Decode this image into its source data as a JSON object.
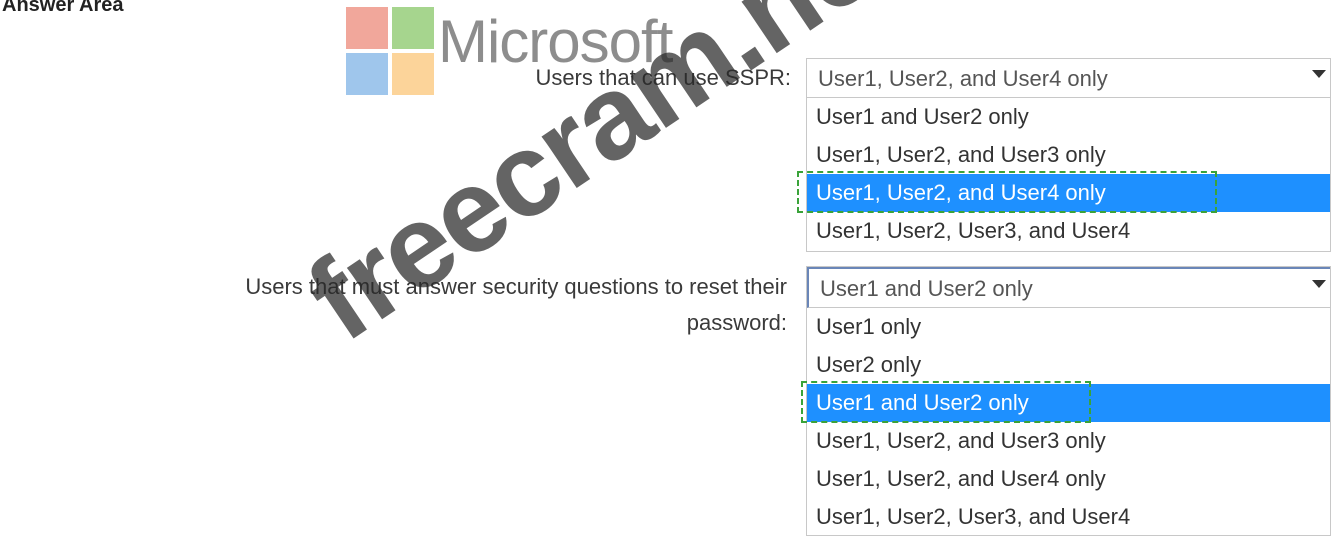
{
  "header": {
    "title": "Answer Area"
  },
  "logo": {
    "wordmark": "Microsoft",
    "colors": [
      "#f1a79b",
      "#a6d58e",
      "#9fc6ec",
      "#fcd49a"
    ]
  },
  "questions": [
    {
      "prompt": "Users that can use SSPR:",
      "selected": "User1, User2, and User4 only",
      "options": [
        "User1 and User2 only",
        "User1, User2, and User3 only",
        "User1, User2, and User4 only",
        "User1, User2, User3, and User4"
      ],
      "highlighted_index": 2
    },
    {
      "prompt": "Users that must answer security questions to reset their password:",
      "selected": "User1 and User2 only",
      "options": [
        "User1 only",
        "User2 only",
        "User1 and User2 only",
        "User1, User2, and User3 only",
        "User1, User2, and User4 only",
        "User1, User2, User3, and User4"
      ],
      "highlighted_index": 2
    }
  ],
  "watermark": {
    "text": "freecram.net"
  },
  "colors": {
    "highlight": "#1e90ff",
    "answer_marker": "#3aa33a"
  }
}
